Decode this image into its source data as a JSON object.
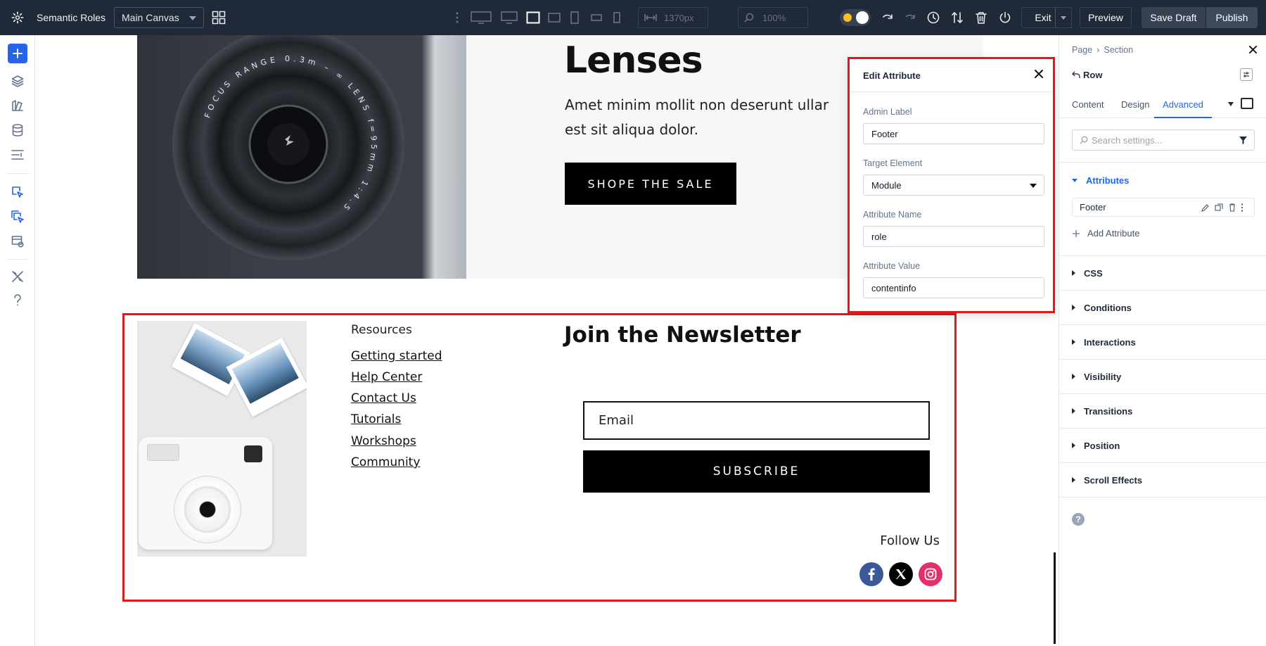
{
  "topbar": {
    "title": "Semantic Roles",
    "canvas_select": "Main Canvas",
    "width_value": "1370px",
    "zoom_value": "100%",
    "exit_label": "Exit",
    "preview_label": "Preview",
    "save_draft_label": "Save Draft",
    "publish_label": "Publish"
  },
  "hero": {
    "heading": "Lenses",
    "body_line1": "Amet minim mollit non deserunt ullar",
    "body_line2": "est sit aliqua dolor.",
    "cta_label": "SHOPE THE SALE",
    "lens_ring_text": "FOCUS RANGE 0.3m – ∞  LENS f=95mm 1:4.5"
  },
  "footer": {
    "resources_heading": "Resources",
    "links": [
      "Getting started",
      "Help Center",
      "Contact Us",
      "Tutorials",
      "Workshops",
      "Community"
    ],
    "newsletter_heading": "Join the Newsletter",
    "email_placeholder": "Email",
    "subscribe_label": "SUBSCRIBE",
    "follow_label": "Follow Us"
  },
  "edit_attribute": {
    "title": "Edit Attribute",
    "admin_label_label": "Admin Label",
    "admin_label_value": "Footer",
    "target_element_label": "Target Element",
    "target_element_value": "Module",
    "attribute_name_label": "Attribute Name",
    "attribute_name_value": "role",
    "attribute_value_label": "Attribute Value",
    "attribute_value_value": "contentinfo"
  },
  "panel": {
    "breadcrumb_page": "Page",
    "breadcrumb_sep": "›",
    "breadcrumb_section": "Section",
    "element_name": "Row",
    "tabs": [
      "Content",
      "Design",
      "Advanced"
    ],
    "active_tab": "Advanced",
    "search_placeholder": "Search settings...",
    "attributes_heading": "Attributes",
    "attribute_item": "Footer",
    "add_attribute_label": "Add Attribute",
    "sections": [
      "CSS",
      "Conditions",
      "Interactions",
      "Visibility",
      "Transitions",
      "Position",
      "Scroll Effects"
    ]
  },
  "colors": {
    "accent_blue": "#2563eb",
    "highlight_red": "#dc1c1c",
    "topbar_bg": "#1f2937",
    "facebook": "#3b5998",
    "instagram": "#e1306c"
  }
}
